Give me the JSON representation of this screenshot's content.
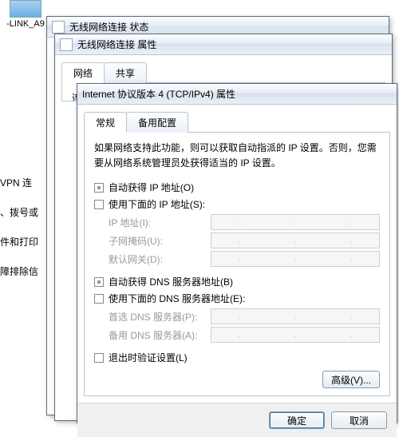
{
  "desktop": {
    "icon_label": "-LINK_A9"
  },
  "side": {
    "vpn": "VPN 连",
    "dial": "、拨号或",
    "printer": "件和打印",
    "troubleshoot": "障排除信"
  },
  "win1": {
    "title": "无线网络连接 状态"
  },
  "win2": {
    "title": "无线网络连接 属性",
    "tab_network": "网络",
    "tab_share": "共享",
    "body_hint": "连接时使用:"
  },
  "win3": {
    "title": "Internet 协议版本 4 (TCP/IPv4) 属性",
    "tab_general": "常规",
    "tab_alt": "备用配置",
    "desc": "如果网络支持此功能，则可以获取自动指派的 IP 设置。否则，您需要从网络系统管理员处获得适当的 IP 设置。",
    "ip_auto": "自动获得 IP 地址(O)",
    "ip_manual": "使用下面的 IP 地址(S):",
    "ip_addr": "IP 地址(I):",
    "subnet": "子网掩码(U):",
    "gateway": "默认网关(D):",
    "dns_auto": "自动获得 DNS 服务器地址(B)",
    "dns_manual": "使用下面的 DNS 服务器地址(E):",
    "dns_pref": "首选 DNS 服务器(P):",
    "dns_alt": "备用 DNS 服务器(A):",
    "validate": "退出时验证设置(L)",
    "advanced": "高级(V)...",
    "ok": "确定",
    "cancel": "取消"
  }
}
